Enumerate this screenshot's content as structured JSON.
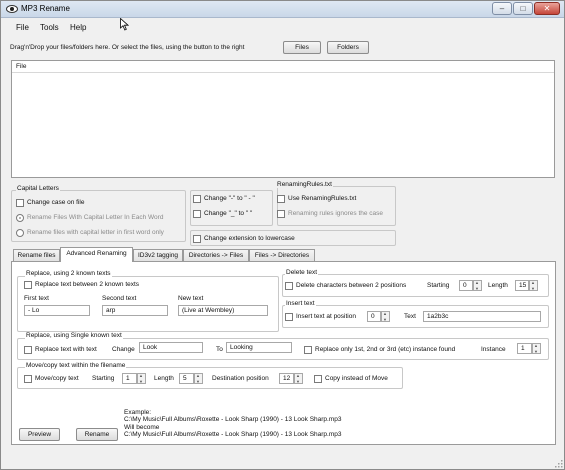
{
  "window": {
    "title": "MP3 Rename",
    "minimize": "–",
    "maximize": "□",
    "close": "✕"
  },
  "menu": [
    "File",
    "Tools",
    "Help"
  ],
  "toolbar": {
    "instruction": "Drag'n'Drop your files/folders here. Or select the files, using the button to the right",
    "files_button": "Files",
    "folders_button": "Folders"
  },
  "file_list": {
    "column_header": "File"
  },
  "capital_letters": {
    "group_label": "Capital Letters",
    "change_case": "Change case on file",
    "option_each_word": "Rename Files With Capital Letter In Each Word",
    "option_first_word": "Rename files with capital letter in first word only"
  },
  "replace_options": {
    "dash_replace": "Change \"-\" to \" - \"",
    "underscore_replace": "Change \"_\" to \" \"",
    "extension_lower": "Change extension to lowercase"
  },
  "renaming_rules": {
    "group_label": "RenamingRules.txt",
    "use": "Use RenamingRules.txt",
    "ignore_case": "Renaming rules ignores the case"
  },
  "tabs": [
    "Rename files",
    "Advanced Renaming",
    "ID3v2 tagging",
    "Directories -> Files",
    "Files -> Directories"
  ],
  "active_tab": 1,
  "adv": {
    "replace2": {
      "label": "Replace, using 2 known texts",
      "checkbox": "Replace text between 2 known texts",
      "first_text_label": "First text",
      "first_text_value": "- Lo",
      "second_text_label": "Second text",
      "second_text_value": "arp",
      "new_text_label": "New text",
      "new_text_value": "(Live at Wembley)"
    },
    "delete": {
      "label": "Delete text",
      "checkbox": "Delete characters between 2 positions",
      "starting_label": "Starting",
      "starting_value": "0",
      "length_label": "Length",
      "length_value": "15"
    },
    "insert": {
      "label": "Insert text",
      "checkbox": "Insert text at position",
      "position_value": "0",
      "text_label": "Text",
      "text_value": "1a2b3c"
    },
    "replace1": {
      "label": "Replace, using Single known text",
      "checkbox": "Replace text with text",
      "change_label": "Change",
      "change_value": "Look",
      "to_label": "To",
      "to_value": "Looking",
      "instance_checkbox": "Replace only 1st, 2nd or 3rd (etc) instance found",
      "instance_label": "Instance",
      "instance_value": "1"
    },
    "move": {
      "label": "Move/copy text within the filename",
      "checkbox": "Move/copy text",
      "starting_label": "Starting",
      "starting_value": "1",
      "length_label": "Length",
      "length_value": "5",
      "dest_label": "Destination position",
      "dest_value": "12",
      "copy_checkbox": "Copy instead of Move"
    },
    "example": [
      "Example:",
      "C:\\My Music\\Full Albums\\Roxette - Look Sharp (1990) - 13 Look Sharp.mp3",
      "Will become",
      "C:\\My Music\\Full Albums\\Roxette - Look Sharp (1990) - 13 Look Sharp.mp3"
    ],
    "preview_button": "Preview",
    "rename_button": "Rename"
  }
}
